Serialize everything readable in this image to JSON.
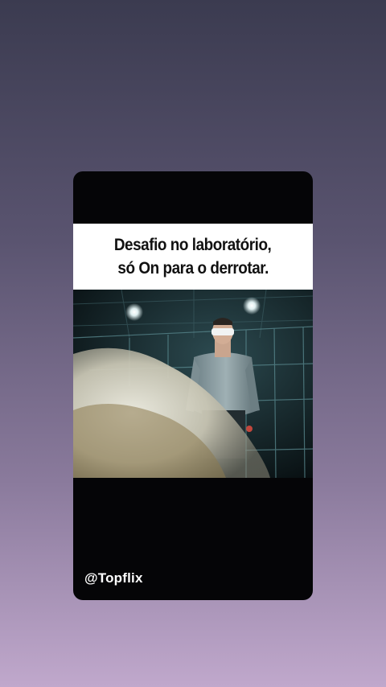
{
  "post": {
    "caption_line1": "Desafio no laboratório,",
    "caption_line2": "só On para o derrotar.",
    "watermark": "@Topflix"
  },
  "colors": {
    "background_top": "#3b3b50",
    "background_bottom": "#c0a8cc",
    "card": "#050507",
    "caption_bg": "#ffffff",
    "caption_text": "#111111"
  }
}
